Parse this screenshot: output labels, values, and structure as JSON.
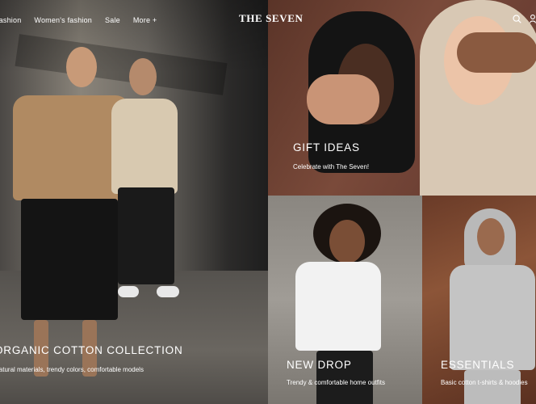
{
  "header": {
    "nav": [
      "Fashion",
      "Women's fashion",
      "Sale",
      "More +"
    ],
    "logo": "THE SEVEN",
    "icons": [
      "search-icon",
      "user-icon"
    ]
  },
  "hero": {
    "title": "ORGANIC COTTON COLLECTION",
    "subtitle": "Natural materials, trendy colors, comfortable models"
  },
  "gift": {
    "title": "GIFT IDEAS",
    "subtitle": "Celebrate with The Seven!"
  },
  "new_drop": {
    "title": "NEW DROP",
    "subtitle": "Trendy & comfortable home outfits"
  },
  "essentials": {
    "title": "ESSENTIALS",
    "subtitle": "Basic cotton t-shirts & hoodies"
  },
  "colors": {
    "text": "#ffffff"
  }
}
